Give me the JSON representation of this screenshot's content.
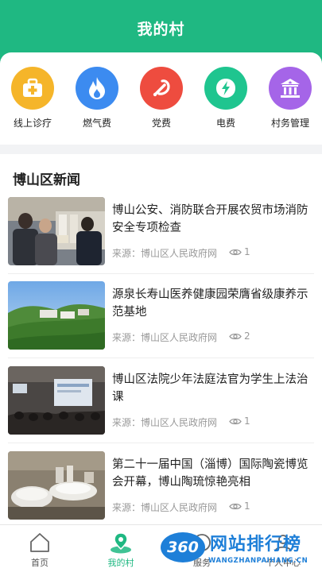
{
  "header": {
    "title": "我的村"
  },
  "services": [
    {
      "label": "线上诊疗",
      "icon": "medical-kit-icon",
      "color": "#f5b52a"
    },
    {
      "label": "燃气费",
      "icon": "flame-icon",
      "color": "#3c8bf0"
    },
    {
      "label": "党费",
      "icon": "party-emblem-icon",
      "color": "#ee4c3f"
    },
    {
      "label": "电费",
      "icon": "lightning-icon",
      "color": "#1fc58f"
    },
    {
      "label": "村务管理",
      "icon": "village-hall-icon",
      "color": "#a565e8"
    }
  ],
  "news": {
    "section_title": "博山区新闻",
    "items": [
      {
        "headline": "博山公安、消防联合开展农贸市场消防安全专项检查",
        "source": "来源：博山区人民政府网",
        "views": "1"
      },
      {
        "headline": "源泉长寿山医养健康园荣膺省级康养示范基地",
        "source": "来源：博山区人民政府网",
        "views": "2"
      },
      {
        "headline": "博山区法院少年法庭法官为学生上法治课",
        "source": "来源：博山区人民政府网",
        "views": "1"
      },
      {
        "headline": "第二十一届中国（淄博）国际陶瓷博览会开幕，博山陶琉惊艳亮相",
        "source": "来源：博山区人民政府网",
        "views": "1"
      }
    ]
  },
  "tabbar": [
    {
      "label": "首页",
      "icon": "home-icon",
      "active": false
    },
    {
      "label": "我的村",
      "icon": "location-pin-icon",
      "active": true
    },
    {
      "label": "服务",
      "icon": "service-icon",
      "active": false
    },
    {
      "label": "个人中心",
      "icon": "user-icon",
      "active": false
    }
  ],
  "watermark": {
    "badge": "360",
    "text": "网站排行榜",
    "url": "WANGZHANPAIHANG.CN"
  }
}
